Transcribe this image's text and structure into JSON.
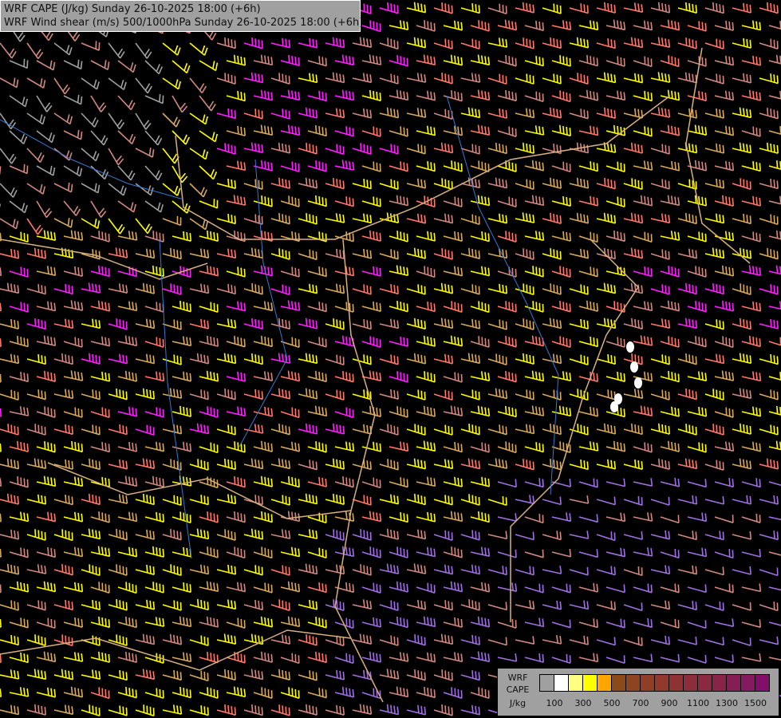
{
  "title": {
    "line1": "WRF CAPE (J/kg) Sunday 26-10-2025 18:00 (+6h)",
    "line2": "WRF Wind shear (m/s) 500/1000hPa Sunday 26-10-2025 18:00 (+6h)"
  },
  "legend": {
    "label_model": "WRF",
    "label_field": "CAPE",
    "label_unit": "J/kg",
    "colors": [
      "#a0a0a0",
      "#ffffff",
      "#ffff80",
      "#ffff00",
      "#ffa500",
      "#8b4a1a",
      "#8e4420",
      "#913e26",
      "#92382c",
      "#8f3232",
      "#8c2e3a",
      "#8a2a42",
      "#88244a",
      "#861e56",
      "#841a60",
      "#820f6a"
    ],
    "ticks": [
      "100",
      "300",
      "500",
      "700",
      "900",
      "1100",
      "1300",
      "1500"
    ]
  },
  "barb_colors": {
    "grey": "#a0a0a0",
    "rose": "#d08a80",
    "salmon": "#ff7a6a",
    "magenta": "#ff20ff",
    "yellow": "#ffff00",
    "tan": "#d8aa60",
    "purple": "#a070e0"
  }
}
